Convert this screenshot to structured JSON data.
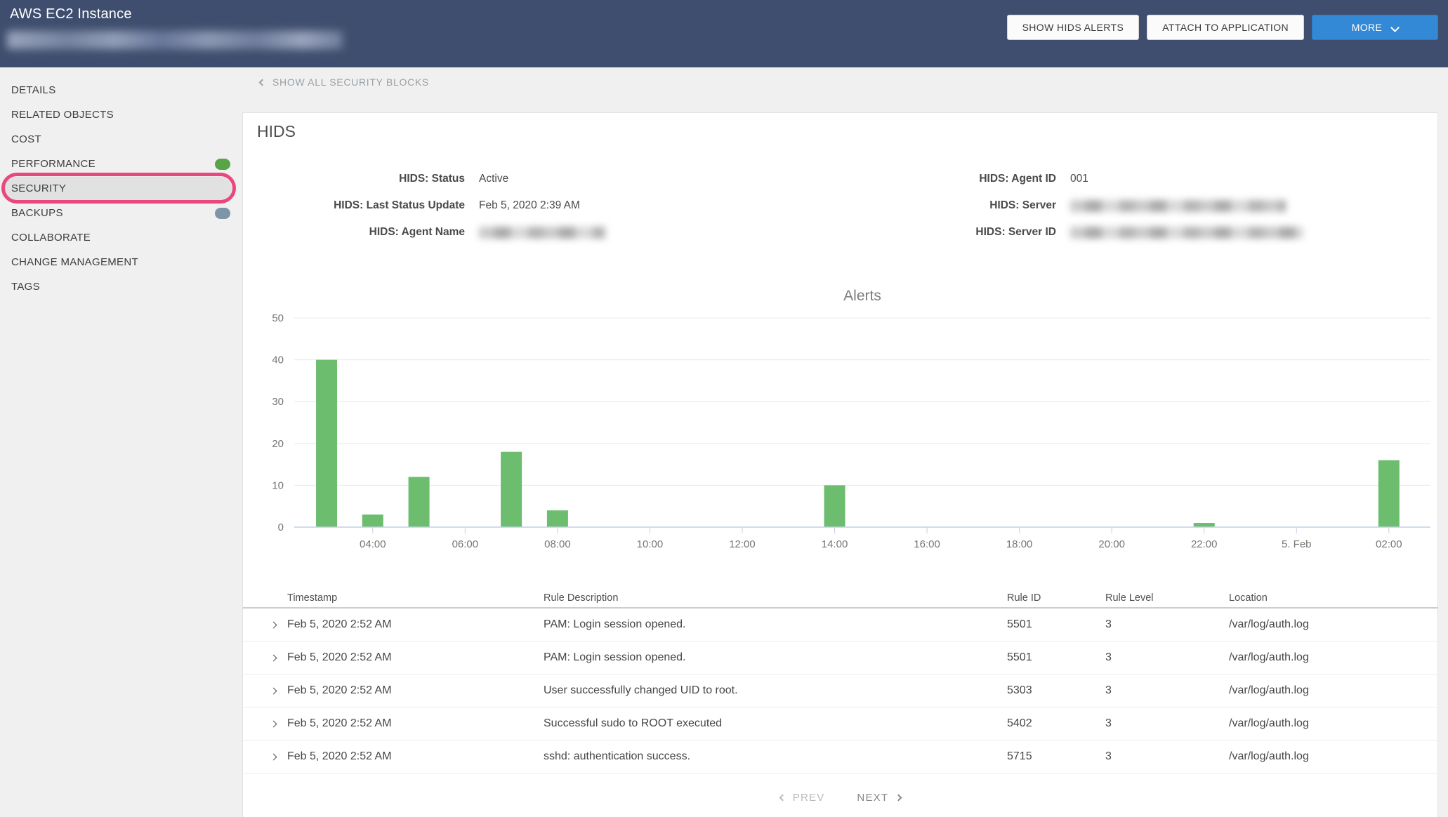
{
  "header": {
    "title": "AWS EC2 Instance",
    "subtitle_redacted": true,
    "buttons": [
      {
        "label": "SHOW HIDS ALERTS"
      },
      {
        "label": "ATTACH TO APPLICATION"
      }
    ],
    "more_label": "MORE"
  },
  "sidebar": {
    "items": [
      {
        "label": "DETAILS"
      },
      {
        "label": "RELATED OBJECTS"
      },
      {
        "label": "COST"
      },
      {
        "label": "PERFORMANCE",
        "status_dot": {
          "name": "performance-status-dot",
          "color": "#59a348"
        }
      },
      {
        "label": "SECURITY",
        "selected": true,
        "annotated": true
      },
      {
        "label": "BACKUPS",
        "status_dot": {
          "name": "backups-status-dot",
          "color": "#7e94a7"
        }
      },
      {
        "label": "COLLABORATE"
      },
      {
        "label": "CHANGE MANAGEMENT"
      },
      {
        "label": "TAGS"
      }
    ]
  },
  "toolbar": {
    "back_link": "SHOW ALL SECURITY BLOCKS"
  },
  "hids": {
    "title": "HIDS",
    "fields_left": [
      {
        "label": "HIDS: Status",
        "value": "Active"
      },
      {
        "label": "HIDS: Last Status Update",
        "value": "Feb 5, 2020 2:39 AM"
      },
      {
        "label": "HIDS: Agent Name",
        "value": "",
        "redacted": true
      }
    ],
    "fields_right": [
      {
        "label": "HIDS: Agent ID",
        "value": "001"
      },
      {
        "label": "HIDS: Server",
        "value": "",
        "redacted": true
      },
      {
        "label": "HIDS: Server ID",
        "value": "",
        "redacted": true
      }
    ]
  },
  "chart_data": {
    "type": "bar",
    "title": "Alerts",
    "xlabel": "",
    "ylabel": "",
    "ylim": [
      0,
      50
    ],
    "yticks": [
      0,
      10,
      20,
      30,
      40,
      50
    ],
    "grid": true,
    "legend": false,
    "bar_color": "#6cbd6e",
    "axis_line_color": "#c3cfe6",
    "x_axis": {
      "unit": "hours (Feb 4 03:00 through Feb 5 02:00)",
      "start_hour": 2.3,
      "end_hour": 26.9,
      "ticks": [
        {
          "hour": 4,
          "label": "04:00"
        },
        {
          "hour": 6,
          "label": "06:00"
        },
        {
          "hour": 8,
          "label": "08:00"
        },
        {
          "hour": 10,
          "label": "10:00"
        },
        {
          "hour": 12,
          "label": "12:00"
        },
        {
          "hour": 14,
          "label": "14:00"
        },
        {
          "hour": 16,
          "label": "16:00"
        },
        {
          "hour": 18,
          "label": "18:00"
        },
        {
          "hour": 20,
          "label": "20:00"
        },
        {
          "hour": 22,
          "label": "22:00"
        },
        {
          "hour": 24,
          "label": "5. Feb"
        },
        {
          "hour": 26,
          "label": "02:00"
        }
      ]
    },
    "points": [
      {
        "label": "Feb 4 03:00",
        "hour": 3,
        "value": 40
      },
      {
        "label": "Feb 4 04:00",
        "hour": 4,
        "value": 3
      },
      {
        "label": "Feb 4 05:00",
        "hour": 5,
        "value": 12
      },
      {
        "label": "Feb 4 07:00",
        "hour": 7,
        "value": 18
      },
      {
        "label": "Feb 4 08:00",
        "hour": 8,
        "value": 4
      },
      {
        "label": "Feb 4 14:00",
        "hour": 14,
        "value": 10
      },
      {
        "label": "Feb 4 22:00",
        "hour": 22,
        "value": 1
      },
      {
        "label": "Feb 5 02:00",
        "hour": 26,
        "value": 16
      }
    ]
  },
  "table": {
    "columns": [
      "Timestamp",
      "Rule Description",
      "Rule ID",
      "Rule Level",
      "Location"
    ],
    "rows": [
      {
        "timestamp": "Feb 5, 2020 2:52 AM",
        "rule_description": "PAM: Login session opened.",
        "rule_id": "5501",
        "rule_level": "3",
        "location": "/var/log/auth.log"
      },
      {
        "timestamp": "Feb 5, 2020 2:52 AM",
        "rule_description": "PAM: Login session opened.",
        "rule_id": "5501",
        "rule_level": "3",
        "location": "/var/log/auth.log"
      },
      {
        "timestamp": "Feb 5, 2020 2:52 AM",
        "rule_description": "User successfully changed UID to root.",
        "rule_id": "5303",
        "rule_level": "3",
        "location": "/var/log/auth.log"
      },
      {
        "timestamp": "Feb 5, 2020 2:52 AM",
        "rule_description": "Successful sudo to ROOT executed",
        "rule_id": "5402",
        "rule_level": "3",
        "location": "/var/log/auth.log"
      },
      {
        "timestamp": "Feb 5, 2020 2:52 AM",
        "rule_description": "sshd: authentication success.",
        "rule_id": "5715",
        "rule_level": "3",
        "location": "/var/log/auth.log"
      }
    ]
  },
  "pagination": {
    "prev": "PREV",
    "next": "NEXT"
  },
  "colors": {
    "header_bg": "#3f4e6e",
    "accent_blue": "#3389d6",
    "bar_green": "#6cbd6e",
    "annotation_pink": "#e8487f",
    "performance_dot": "#59a348",
    "backups_dot": "#7e94a7"
  }
}
